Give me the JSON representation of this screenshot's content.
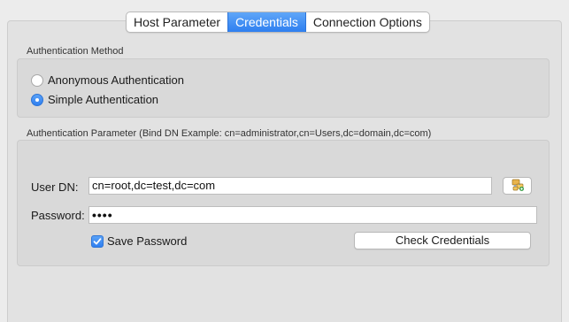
{
  "tabs": [
    {
      "label": "Host Parameter",
      "active": false
    },
    {
      "label": "Credentials",
      "active": true
    },
    {
      "label": "Connection Options",
      "active": false
    }
  ],
  "auth_method": {
    "title": "Authentication Method",
    "options": [
      {
        "label": "Anonymous Authentication",
        "selected": false
      },
      {
        "label": "Simple Authentication",
        "selected": true
      }
    ]
  },
  "auth_param": {
    "title": "Authentication Parameter (Bind DN Example: cn=administrator,cn=Users,dc=domain,dc=com)",
    "user_dn_label": "User DN:",
    "user_dn_value": "cn=root,dc=test,dc=com",
    "browse_icon": "directory-browse-icon",
    "password_label": "Password:",
    "password_value": "••••",
    "save_password_label": "Save Password",
    "save_password_checked": true,
    "check_button_label": "Check Credentials"
  },
  "colors": {
    "accent": "#2f7ff0",
    "panel": "#e2e2e2",
    "group": "#d9d9d9"
  }
}
